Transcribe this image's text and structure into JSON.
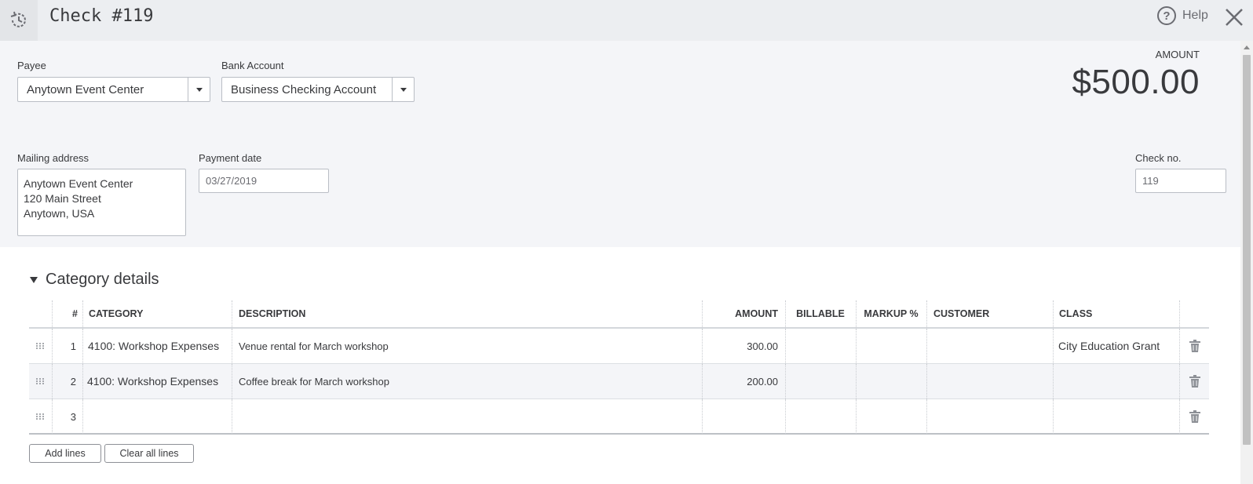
{
  "header": {
    "title": "Check #119",
    "help_label": "Help",
    "history_icon": "history-clock-icon",
    "close_icon": "close-icon"
  },
  "form": {
    "payee_label": "Payee",
    "payee_value": "Anytown Event Center",
    "bank_account_label": "Bank Account",
    "bank_account_value": "Business Checking Account",
    "amount_label": "AMOUNT",
    "amount_value": "$500.00",
    "mailing_address_label": "Mailing address",
    "mailing_address_lines": [
      "Anytown Event Center",
      "120 Main Street",
      "Anytown, USA"
    ],
    "payment_date_label": "Payment date",
    "payment_date_value": "03/27/2019",
    "check_no_label": "Check no.",
    "check_no_value": "119"
  },
  "category_details": {
    "title": "Category details",
    "columns": {
      "number": "#",
      "category": "CATEGORY",
      "description": "DESCRIPTION",
      "amount": "AMOUNT",
      "billable": "BILLABLE",
      "markup": "MARKUP %",
      "customer": "CUSTOMER",
      "class": "CLASS"
    },
    "rows": [
      {
        "num": "1",
        "category": "4100: Workshop Expenses",
        "description": "Venue rental for March workshop",
        "amount": "300.00",
        "billable": "",
        "markup": "",
        "customer": "",
        "class": "City Education Grant"
      },
      {
        "num": "2",
        "category": "4100: Workshop Expenses",
        "description": "Coffee break for March workshop",
        "amount": "200.00",
        "billable": "",
        "markup": "",
        "customer": "",
        "class": ""
      },
      {
        "num": "3",
        "category": "",
        "description": "",
        "amount": "",
        "billable": "",
        "markup": "",
        "customer": "",
        "class": ""
      }
    ],
    "add_lines_label": "Add lines",
    "clear_all_lines_label": "Clear all lines"
  }
}
